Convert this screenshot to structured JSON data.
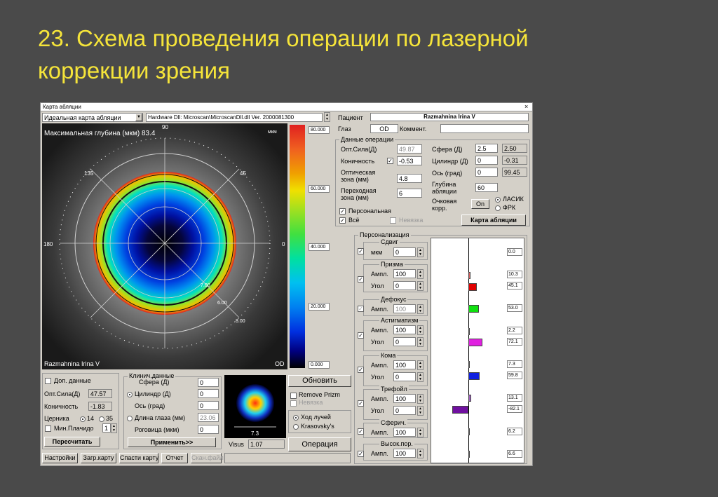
{
  "slide": {
    "title_line1": "23. Схема проведения операции по лазерной",
    "title_line2": "коррекции зрения"
  },
  "window": {
    "title": "Карта абляции",
    "close": "×"
  },
  "map": {
    "dropdown": "Идеальная карта абляции",
    "hardware": "Hardware Dll: Microscan\\MicroscanDll.dll Ver. 2000081300",
    "max_depth": "Максимальная глубина (мкм) 83.4",
    "unit": "мкм",
    "patient_corner": "Razmahnina Irina V",
    "eye_corner": "OD",
    "angles": {
      "top": "90",
      "a45": "45",
      "a135": "135",
      "left": "180",
      "right": "0"
    },
    "rings": [
      "7.00",
      "6.00",
      "8.00"
    ],
    "scale": [
      "80.000",
      "60.000",
      "40.000",
      "20.000",
      "0.000"
    ],
    "colors": {
      "accent_band": "#a0e020",
      "ring_line": "#111111"
    }
  },
  "patient": {
    "label": "Пациент",
    "name": "Razmahnina Irina V",
    "eye_label": "Глаз",
    "eye": "OD",
    "comment_label": "Коммент.",
    "comment": ""
  },
  "operation": {
    "header": "Данные операции",
    "opt_label": "Опт.Сила(Д)",
    "opt_value": "49.87",
    "con_label": "Коничность",
    "con_value": "-0.53",
    "oz_label1": "Оптическая",
    "oz_label2": "зона (мм)",
    "oz_value": "4.8",
    "tz_label1": "Переходная",
    "tz_label2": "зона (мм)",
    "tz_value": "6",
    "sph_label": "Сфера (Д)",
    "sph_value": "2.5",
    "sph_calc": "2.50",
    "cyl_label": "Цилиндр (Д)",
    "cyl_value": "0",
    "cyl_calc": "-0.31",
    "axis_label": "Ось (град)",
    "axis_value": "0",
    "axis_calc": "99.45",
    "depth_label1": "Глубина",
    "depth_label2": "абляции",
    "depth_value": "60",
    "glasses_label1": "Очковая",
    "glasses_label2": "корр.",
    "glasses_value": "On",
    "lasik": "ЛАСИК",
    "prk": "ФРК",
    "personal": "Персональная",
    "all": "Всё",
    "misalign": "Невязка",
    "map_button": "Карта абляции"
  },
  "personalization": {
    "header": "Персонализация",
    "unit_mkm": "мкм",
    "amp": "Ампл.",
    "angle": "Угол",
    "groups": [
      {
        "name": "Сдвиг",
        "v1": "0",
        "v2": ""
      },
      {
        "name": "Призма",
        "v1": "100",
        "v2": "0"
      },
      {
        "name": "Дефокус",
        "v1": "100",
        "v2": ""
      },
      {
        "name": "Астигматизм",
        "v1": "100",
        "v2": "0"
      },
      {
        "name": "Кома",
        "v1": "100",
        "v2": "0"
      },
      {
        "name": "Трефойл",
        "v1": "100",
        "v2": "0"
      },
      {
        "name": "Сферич.",
        "v1": "100",
        "v2": ""
      },
      {
        "name": "Высок.пор.",
        "v1": "100",
        "v2": ""
      }
    ],
    "readings": [
      "0.0",
      "10.3",
      "45.1",
      "53.0",
      "2.2",
      "72.1",
      "7.3",
      "59.8",
      "13.1",
      "-82.1",
      "6.2",
      "6.6"
    ],
    "bars": [
      {
        "value": 10.3,
        "color": "#e06060"
      },
      {
        "value": 45.1,
        "color": "#e00000"
      },
      {
        "value": 53.0,
        "color": "#10e010"
      },
      {
        "value": 2.2,
        "color": "#d0d0a0"
      },
      {
        "value": 72.1,
        "color": "#e020e0"
      },
      {
        "value": 7.3,
        "color": "#d0c060"
      },
      {
        "value": 59.8,
        "color": "#1020e0"
      },
      {
        "value": 13.1,
        "color": "#a060c0"
      },
      {
        "value": -82.1,
        "color": "#7010a0"
      },
      {
        "value": 6.2,
        "color": "#c0c0c0"
      },
      {
        "value": 6.6,
        "color": "#c0c0c0"
      }
    ]
  },
  "bottom": {
    "extra_data": "Доп. данные",
    "opt_label": "Опт.Сила(Д)",
    "opt_value": "47.57",
    "con_label": "Коничность",
    "con_value": "-1.83",
    "cerniki": "Церника",
    "c14": "14",
    "c35": "35",
    "placido": "Мин.Плачидо",
    "placido_value": "1",
    "recalc": "Пересчитать",
    "clinic1": "Клинич.данные",
    "clinic2": "Сфера (Д)",
    "sph": "0",
    "cyl_label": "Цилиндр (Д)",
    "cyl": "0",
    "axis_label": "Ось (град)",
    "axis": "0",
    "eye_len_label": "Длина глаза (мм)",
    "eye_len": "23.06",
    "cornea_label": "Роговица (мкм)",
    "cornea": "0",
    "apply": "Применить>>",
    "preview_value": "7.3",
    "visus_label": "Visus",
    "visus": "1.07",
    "update": "Обновить",
    "remove_prizm": "Remove Prizm",
    "misalign": "Невязка",
    "ray": "Ход лучей",
    "krasovsky": "Krasovsky's",
    "operation": "Операция"
  },
  "footer": {
    "settings": "Настройки",
    "load": "Загр.карту",
    "save": "Спасти карту",
    "report": "Отчет",
    "scan": "Скан.файл"
  }
}
